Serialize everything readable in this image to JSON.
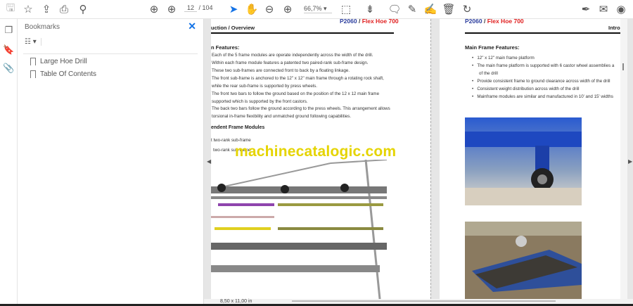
{
  "toolbar": {
    "current_page": "12",
    "total_pages": "/ 104",
    "zoom": "66,7%"
  },
  "bookmarks": {
    "title": "Bookmarks",
    "items": [
      {
        "label": "Large Hoe Drill"
      },
      {
        "label": "Table Of Contents"
      }
    ]
  },
  "left_page": {
    "brand_model": "P2060",
    "brand_sep": " / ",
    "brand_name": "Flex Hoe 700",
    "section": "uction / Overview",
    "features_title": "n Features:",
    "lines": [
      "Each of the 5 frame modules are operate independently across the width of the drill.",
      "Within each frame module features a patented two paired-rank sub-frame design.",
      "These two sub-frames are connected front to back by a floating linkage.",
      "The front sub-frame is anchored to the 12\" x 12\" main frame through a rotating rock shaft,",
      "while the rear sub-frame is supported by press wheels.",
      "The front two bars to follow the ground based on the position of the 12 x 12 main frame",
      "supported which is supported by the front castors.",
      "The back two bars follow the ground according to the press wheels. This arrangement allows",
      "torsional in-frame flexibility and unmatched ground following capabilities."
    ],
    "modules_title": "endent Frame Modules",
    "module_lines": [
      "t two-rank sub-frame",
      "two-rank sub-frame"
    ]
  },
  "right_page": {
    "brand_model": "P2060",
    "brand_sep": " / ",
    "brand_name": "Flex Hoe 700",
    "section": "Intro",
    "features_title": "Main Frame Features:",
    "bullets": [
      "12\" x 12\" main frame platform",
      "The main frame platform is supported with 6 castor wheel assemblies a",
      "of the drill",
      "Provide consistent frame to ground clearance across width of the drill",
      "Consistent weight distribution across width of the drill",
      "Mainframe modules are similar and manufactured in 10' and 15' widths"
    ]
  },
  "watermark": "machinecatalogic.com",
  "status": {
    "page_size": "8,50 x 11,00 in"
  }
}
